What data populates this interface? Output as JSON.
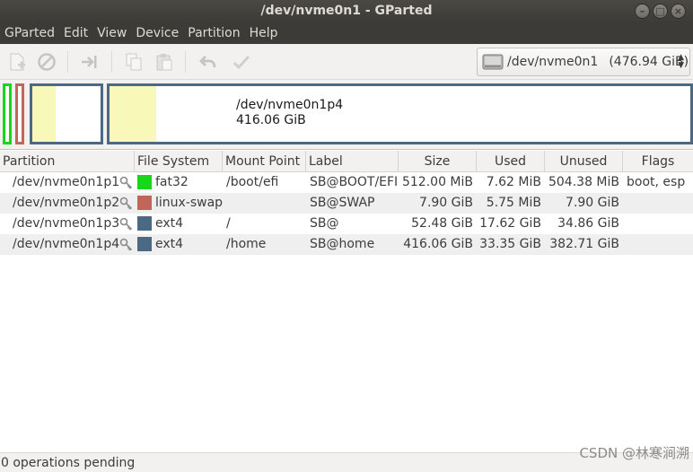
{
  "window": {
    "title": "/dev/nvme0n1 - GParted"
  },
  "menubar": {
    "items": [
      "GParted",
      "Edit",
      "View",
      "Device",
      "Partition",
      "Help"
    ]
  },
  "device_selector": {
    "name": "/dev/nvme0n1",
    "size": "(476.94 GiB)"
  },
  "disk_map": {
    "label_name": "/dev/nvme0n1p4",
    "label_size": "416.06 GiB",
    "colors": {
      "fat32": "#18d618",
      "linux-swap": "#c1665a",
      "ext4": "#4b6983",
      "used": "#f8f8b9"
    }
  },
  "table": {
    "headers": {
      "partition": "Partition",
      "filesystem": "File System",
      "mount": "Mount Point",
      "label": "Label",
      "size": "Size",
      "used": "Used",
      "unused": "Unused",
      "flags": "Flags"
    },
    "rows": [
      {
        "partition": "/dev/nvme0n1p1",
        "filesystem": "fat32",
        "fs_color": "#18d618",
        "mount": "/boot/efi",
        "label": "SB@BOOT/EFI",
        "size": "512.00 MiB",
        "used": "7.62 MiB",
        "unused": "504.38 MiB",
        "flags": "boot, esp"
      },
      {
        "partition": "/dev/nvme0n1p2",
        "filesystem": "linux-swap",
        "fs_color": "#c1665a",
        "mount": "",
        "label": "SB@SWAP",
        "size": "7.90 GiB",
        "used": "5.75 MiB",
        "unused": "7.90 GiB",
        "flags": ""
      },
      {
        "partition": "/dev/nvme0n1p3",
        "filesystem": "ext4",
        "fs_color": "#4b6983",
        "mount": "/",
        "label": "SB@",
        "size": "52.48 GiB",
        "used": "17.62 GiB",
        "unused": "34.86 GiB",
        "flags": ""
      },
      {
        "partition": "/dev/nvme0n1p4",
        "filesystem": "ext4",
        "fs_color": "#4b6983",
        "mount": "/home",
        "label": "SB@home",
        "size": "416.06 GiB",
        "used": "33.35 GiB",
        "unused": "382.71 GiB",
        "flags": ""
      }
    ]
  },
  "statusbar": {
    "text": "0 operations pending"
  },
  "watermark": {
    "text": "CSDN @林寒涧溯"
  },
  "toolbar_icons": [
    "new-partition-icon",
    "delete-icon",
    "resize-move-icon",
    "copy-icon",
    "paste-icon",
    "undo-icon",
    "apply-icon"
  ]
}
